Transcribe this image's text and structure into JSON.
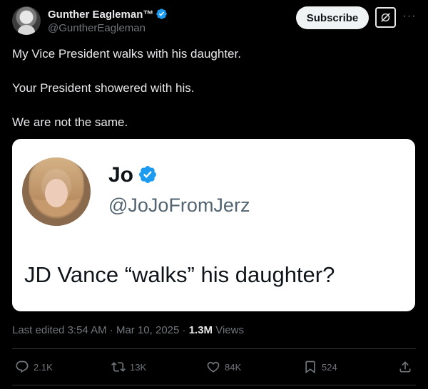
{
  "author": {
    "display_name": "Gunther Eagleman™",
    "handle": "@GuntherEagleman"
  },
  "header": {
    "subscribe_label": "Subscribe",
    "grok_icon": "grok-icon",
    "more_icon": "more-icon"
  },
  "tweet": {
    "lines": [
      "My Vice President walks with his daughter.",
      "Your President showered with his.",
      "We are not the same."
    ]
  },
  "embedded": {
    "name": "Jo",
    "handle": "@JoJoFromJerz",
    "text": "JD Vance “walks” his daughter?"
  },
  "meta": {
    "edited_prefix": "Last edited",
    "time": "3:54 AM",
    "sep1": " · ",
    "date": "Mar 10, 2025",
    "sep2": " · ",
    "views_count": "1.3M",
    "views_label": " Views"
  },
  "actions": {
    "replies": "2.1K",
    "reposts": "13K",
    "likes": "84K",
    "bookmarks": "524"
  },
  "colors": {
    "background": "#000000",
    "text": "#e7e9ea",
    "secondary": "#71767b",
    "verified": "#1d9bf0",
    "divider": "#2f3336"
  }
}
